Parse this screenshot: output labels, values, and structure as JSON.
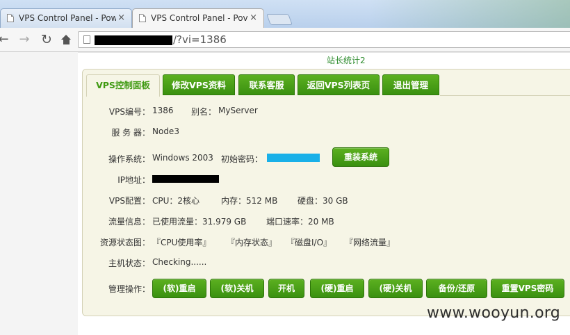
{
  "browser": {
    "tabs": [
      {
        "title": "VPS Control Panel - Pow",
        "close": "×"
      },
      {
        "title": "VPS Control Panel - Pov",
        "close": "×"
      }
    ],
    "url_visible_tail": "/?vi=1386"
  },
  "page": {
    "stat_link": "站长统计2",
    "nav": [
      "VPS控制面板",
      "修改VPS资料",
      "联系客服",
      "返回VPS列表页",
      "退出管理"
    ],
    "info": {
      "vps_id_label": "VPS编号：",
      "vps_id": "1386",
      "alias_label": "别名：",
      "alias": "MyServer",
      "server_label": "服 务 器：",
      "server": "Node3",
      "os_label": "操作系统：",
      "os": "Windows 2003",
      "init_pwd_label": "初始密码：",
      "reinstall_button": "重装系统",
      "ip_label": "IP地址：",
      "config_label": "VPS配置：",
      "cpu": "CPU：2核心",
      "mem": "内存：512 MB",
      "disk": "硬盘：30 GB",
      "traffic_label": "流量信息：",
      "traffic_used": "已使用流量：31.979 GB",
      "port_speed": "端口速率：20 MB",
      "resource_label": "资源状态图：",
      "res_cpu": "『CPU使用率』",
      "res_mem": "『内存状态』",
      "res_disk": "『磁盘I/O』",
      "res_net": "『网络流量』",
      "host_status_label": "主机状态：",
      "host_status": "Checking......",
      "manage_label": "管理操作："
    },
    "manage_buttons": [
      "(软)重启",
      "(软)关机",
      "开机",
      "(硬)重启",
      "(硬)关机",
      "备份/还原",
      "重置VPS密码"
    ]
  },
  "watermark": "www.wooyun.org",
  "colors": {
    "accent_green": "#3f9a12",
    "panel_bg": "#f6f5e6",
    "redacted_password": "#19b0e8"
  }
}
